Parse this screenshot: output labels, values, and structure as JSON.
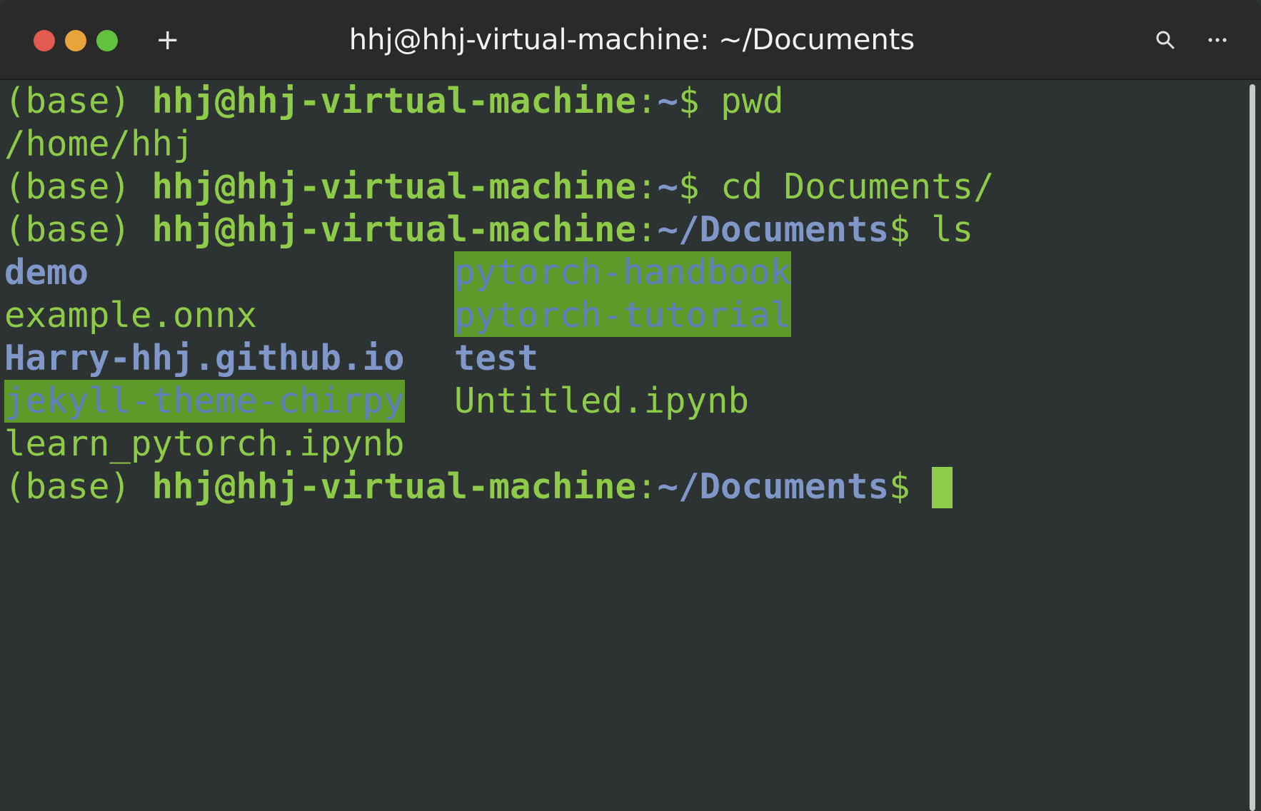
{
  "window": {
    "title": "hhj@hhj-virtual-machine: ~/Documents",
    "new_tab_symbol": "+",
    "search_icon": "search-icon",
    "menu_icon": "ellipsis-icon",
    "colors": {
      "close": "#e25a50",
      "minimize": "#e8a43a",
      "maximize": "#62c23f"
    }
  },
  "terminal": {
    "colors": {
      "background": "#2d3233",
      "text_green": "#8ecb48",
      "path_blue": "#7f97c9",
      "highlight_bg": "#5e9a2a"
    },
    "lines": [
      {
        "prefix": "(base) ",
        "user": "hhj@hhj-virtual-machine",
        "sep": ":",
        "path": "~",
        "dollar": "$ ",
        "cmd": "pwd"
      },
      {
        "output": "/home/hhj"
      },
      {
        "prefix": "(base) ",
        "user": "hhj@hhj-virtual-machine",
        "sep": ":",
        "path": "~",
        "dollar": "$ ",
        "cmd": "cd Documents/"
      },
      {
        "prefix": "(base) ",
        "user": "hhj@hhj-virtual-machine",
        "sep": ":",
        "path": "~/Documents",
        "dollar": "$ ",
        "cmd": "ls"
      }
    ],
    "ls_rows": [
      {
        "left": "demo",
        "right": "pytorch-handbook"
      },
      {
        "left": "example.onnx",
        "right": "pytorch-tutorial"
      },
      {
        "left": "Harry-hhj.github.io",
        "right": "test"
      },
      {
        "left": "jekyll-theme-chirpy",
        "right": "Untitled.ipynb"
      },
      {
        "left": "learn_pytorch.ipynb",
        "right": ""
      }
    ],
    "final_prompt": {
      "prefix": "(base) ",
      "user": "hhj@hhj-virtual-machine",
      "sep": ":",
      "path": "~/Documents",
      "dollar": "$ "
    }
  }
}
